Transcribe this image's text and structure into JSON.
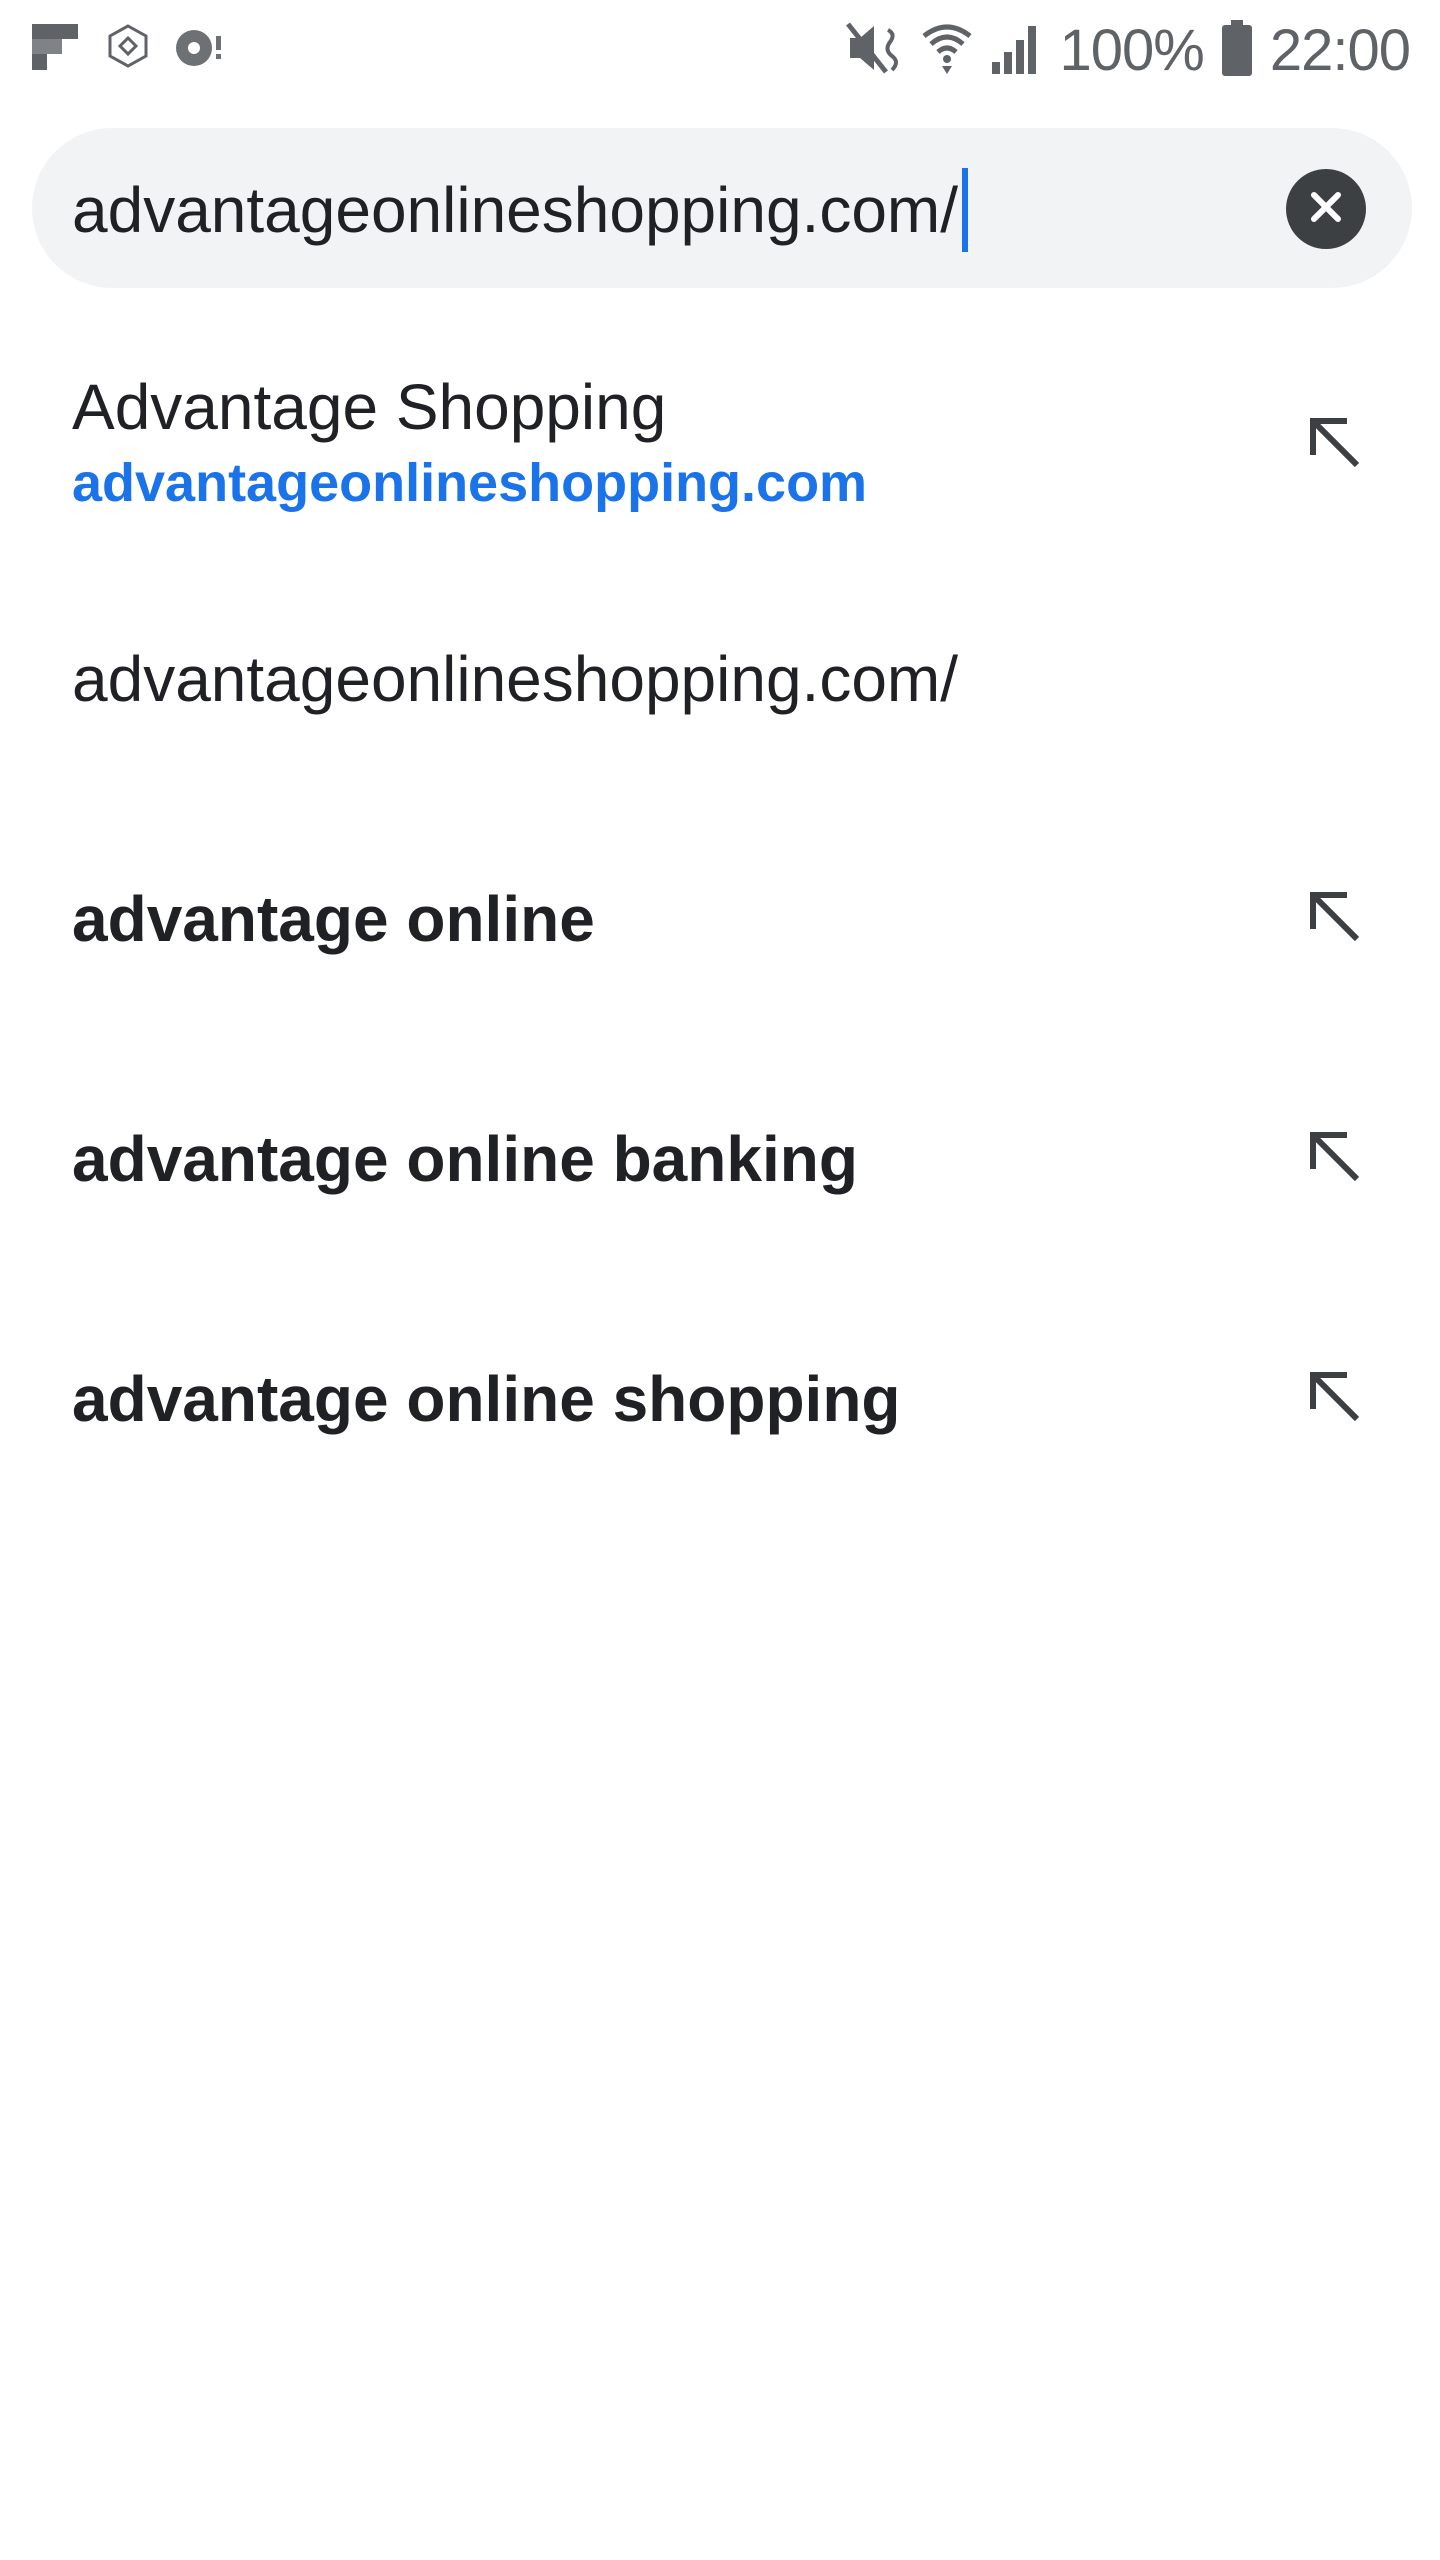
{
  "status_bar": {
    "battery_percent": "100%",
    "time": "22:00",
    "left_icons": [
      "flipboard-icon",
      "app-icon",
      "music-sync-icon"
    ],
    "right_icons": [
      "mute-icon",
      "wifi-icon",
      "signal-icon",
      "battery-icon"
    ]
  },
  "omnibox": {
    "value": "advantageonlineshopping.com/",
    "clear_icon": "close-icon"
  },
  "suggestions": [
    {
      "type": "site",
      "title": "Advantage Shopping",
      "url": "advantageonlineshopping.com",
      "action_icon": "arrow-up-left-icon"
    },
    {
      "type": "typed",
      "text": "advantageonlineshopping.com/"
    },
    {
      "type": "search",
      "text": "advantage online",
      "action_icon": "arrow-up-left-icon"
    },
    {
      "type": "search",
      "text": "advantage online banking",
      "action_icon": "arrow-up-left-icon"
    },
    {
      "type": "search",
      "text": "advantage online shopping",
      "action_icon": "arrow-up-left-icon"
    }
  ],
  "colors": {
    "accent": "#1a73e8",
    "omnibox_bg": "#f1f3f4",
    "text": "#202124",
    "icon": "#3c4043"
  }
}
